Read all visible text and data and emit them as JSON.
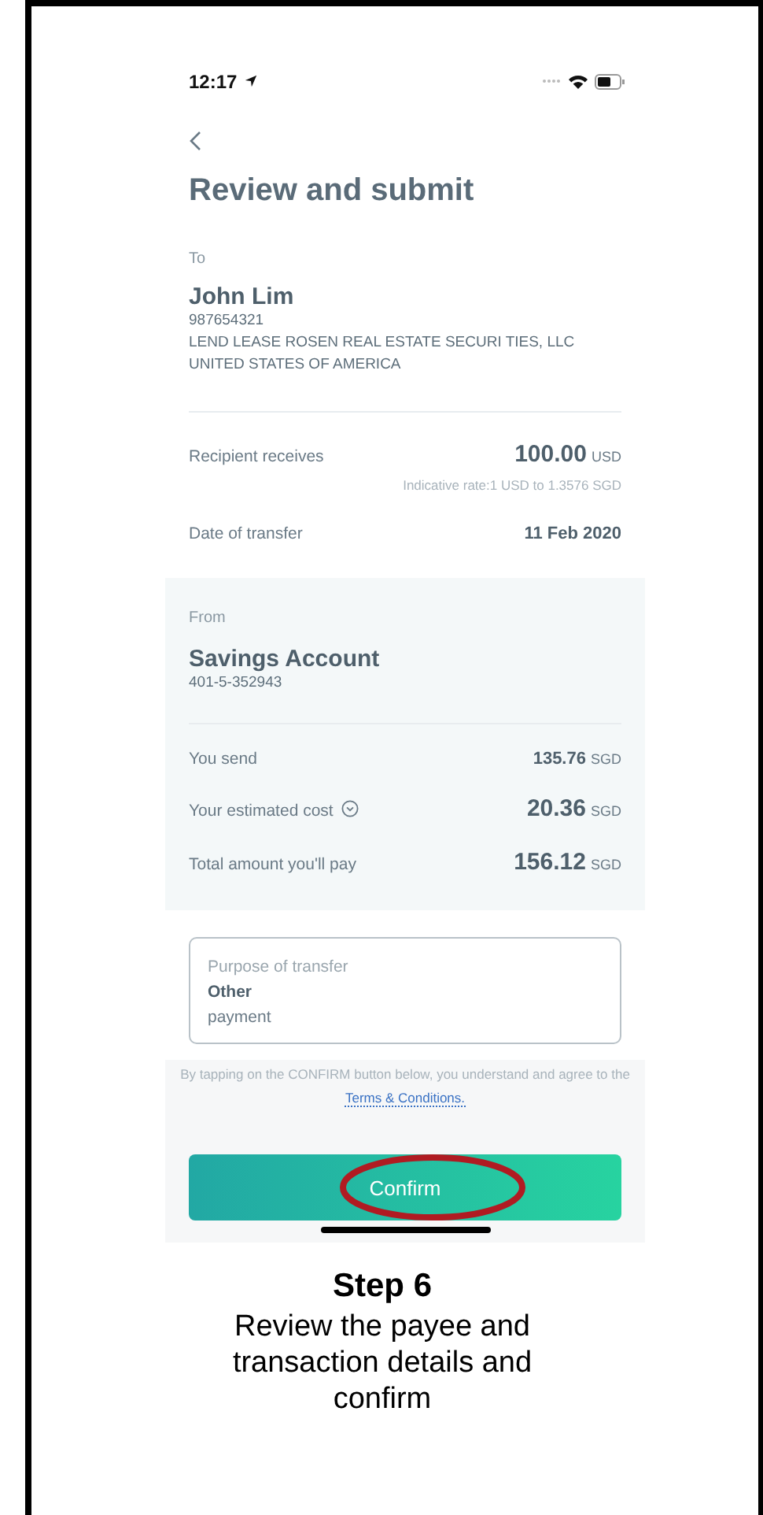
{
  "status_bar": {
    "time": "12:17"
  },
  "title": "Review and submit",
  "to": {
    "label": "To",
    "name": "John Lim",
    "account": "987654321",
    "company": "LEND LEASE ROSEN REAL ESTATE SECURI TIES, LLC",
    "country": "UNITED STATES OF AMERICA"
  },
  "details": [
    {
      "label": "Recipient receives",
      "amount": "100.00",
      "currency": "USD",
      "kind": "large",
      "note": "Indicative rate:1 USD to 1.3576 SGD"
    },
    {
      "label": "Date of transfer",
      "amount": "11 Feb 2020",
      "kind": "date"
    }
  ],
  "from": {
    "label": "From",
    "name": "Savings Account",
    "account": "401-5-352943"
  },
  "costs": [
    {
      "label": "You send",
      "amount": "135.76",
      "currency": "SGD",
      "kind": "small",
      "expandable": false
    },
    {
      "label": "Your estimated cost",
      "amount": "20.36",
      "currency": "SGD",
      "kind": "large",
      "expandable": true
    },
    {
      "label": "Total amount you'll pay",
      "amount": "156.12",
      "currency": "SGD",
      "kind": "large",
      "expandable": false
    }
  ],
  "purpose": {
    "label": "Purpose of transfer",
    "value": "Other",
    "detail": "payment"
  },
  "terms": {
    "text": "By tapping on the CONFIRM button below, you understand and agree to the",
    "link": "Terms & Conditions."
  },
  "confirm_button": {
    "label": "Confirm",
    "highlighted": true
  },
  "caption": {
    "title": "Step 6",
    "text": "Review the payee and transaction details and confirm"
  }
}
